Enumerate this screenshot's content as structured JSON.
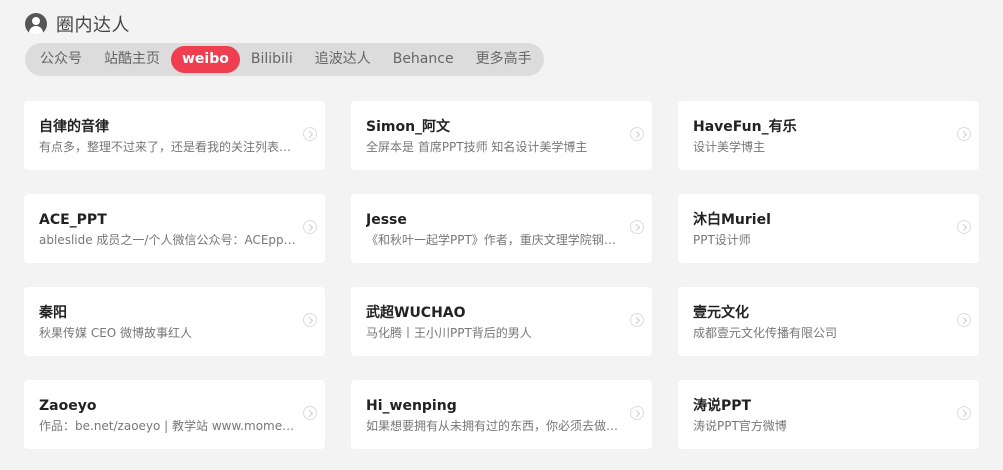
{
  "header": {
    "title": "圈内达人",
    "icon": "user-circle-icon"
  },
  "tabs": [
    {
      "label": "公众号",
      "active": false
    },
    {
      "label": "站酷主页",
      "active": false
    },
    {
      "label": "weibo",
      "active": true
    },
    {
      "label": "Bilibili",
      "active": false
    },
    {
      "label": "追波达人",
      "active": false
    },
    {
      "label": "Behance",
      "active": false
    },
    {
      "label": "更多高手",
      "active": false
    }
  ],
  "accent_color": "#ef3e4f",
  "cards": [
    {
      "name": "自律的音律",
      "desc": "有点多，整理不过来了，还是看我的关注列表顺吧"
    },
    {
      "name": "Simon_阿文",
      "desc": "全屏本是 首席PPT技师 知名设计美学博主"
    },
    {
      "name": "HaveFun_有乐",
      "desc": "设计美学博主"
    },
    {
      "name": "ACE_PPT",
      "desc": "ableslide 成员之一/个人微信公众号：ACEppteam"
    },
    {
      "name": "Jesse",
      "desc": "《和秋叶一起学PPT》作者，重庆文理学院钢琴系"
    },
    {
      "name": "沐白Muriel",
      "desc": "PPT设计师"
    },
    {
      "name": "秦阳",
      "desc": "秋果传媒 CEO 微博故事红人"
    },
    {
      "name": "武超WUCHAO",
      "desc": "马化腾丨王小川PPT背后的男人"
    },
    {
      "name": "壹元文化",
      "desc": "成都壹元文化传播有限公司"
    },
    {
      "name": "Zaoeyo",
      "desc": "作品：be.net/zaoeyo | 教学站 www.momentool.com"
    },
    {
      "name": "Hi_wenping",
      "desc": "如果想要拥有从未拥有过的东西，你必须去做从未做过的事"
    },
    {
      "name": "涛说PPT",
      "desc": "涛说PPT官方微博"
    }
  ]
}
